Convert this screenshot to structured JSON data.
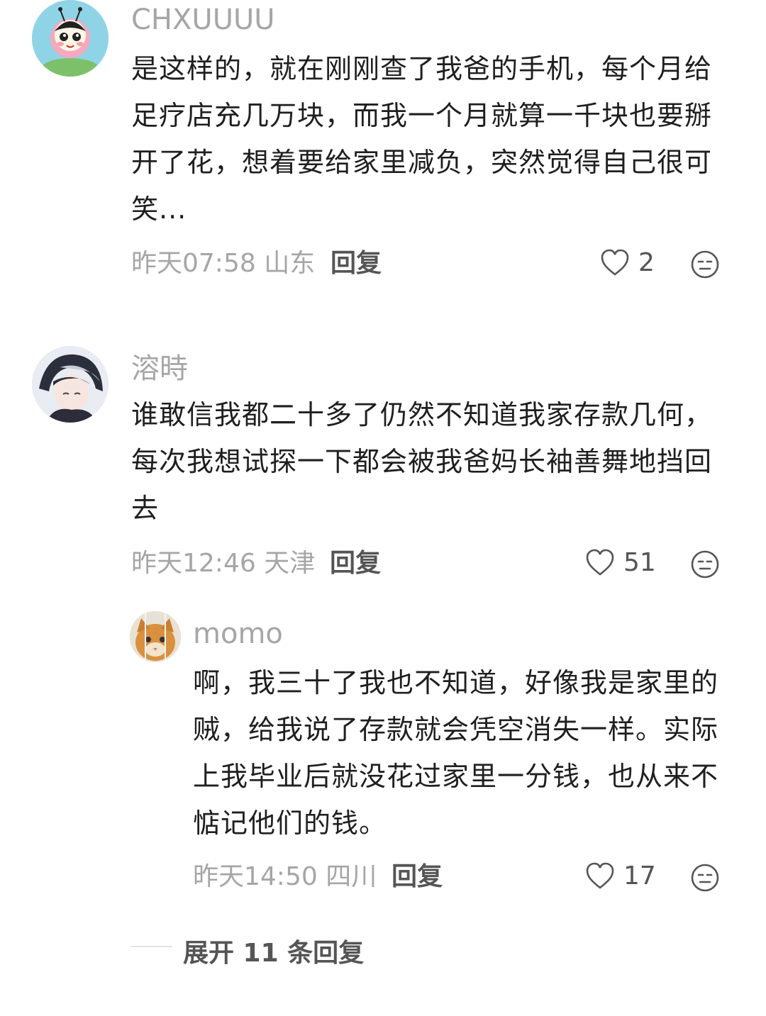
{
  "comments": [
    {
      "username": "CHXUUUU",
      "avatar": "ladybug-cartoon-avatar",
      "text": "是这样的，就在刚刚查了我爸的手机，每个月给足疗店充几万块，而我一个月就算一千块也要掰开了花，想着要给家里减负，突然觉得自己很可笑...",
      "time_location": "昨天07:58 山东",
      "reply_label": "回复",
      "likes": "2"
    },
    {
      "username": "溶時",
      "avatar": "anime-boy-avatar",
      "text": "谁敢信我都二十多了仍然不知道我家存款几何，每次我想试探一下都会被我爸妈长袖善舞地挡回去",
      "time_location": "昨天12:46 天津",
      "reply_label": "回复",
      "likes": "51"
    }
  ],
  "reply": {
    "username": "momo",
    "avatar": "cat-photo-avatar",
    "text": "啊，我三十了我也不知道，好像我是家里的贼，给我说了存款就会凭空消失一样。实际上我毕业后就没花过家里一分钱，也从来不惦记他们的钱。",
    "time_location": "昨天14:50 四川",
    "reply_label": "回复",
    "likes": "17"
  },
  "expand_label": "展开 11 条回复",
  "icons": {
    "like": "heart-outline-icon",
    "dislike": "meh-face-icon"
  },
  "colors": {
    "username": "#a6a6a6",
    "text": "#1f1f1f",
    "meta": "#a6a6a6",
    "action": "#555555"
  }
}
